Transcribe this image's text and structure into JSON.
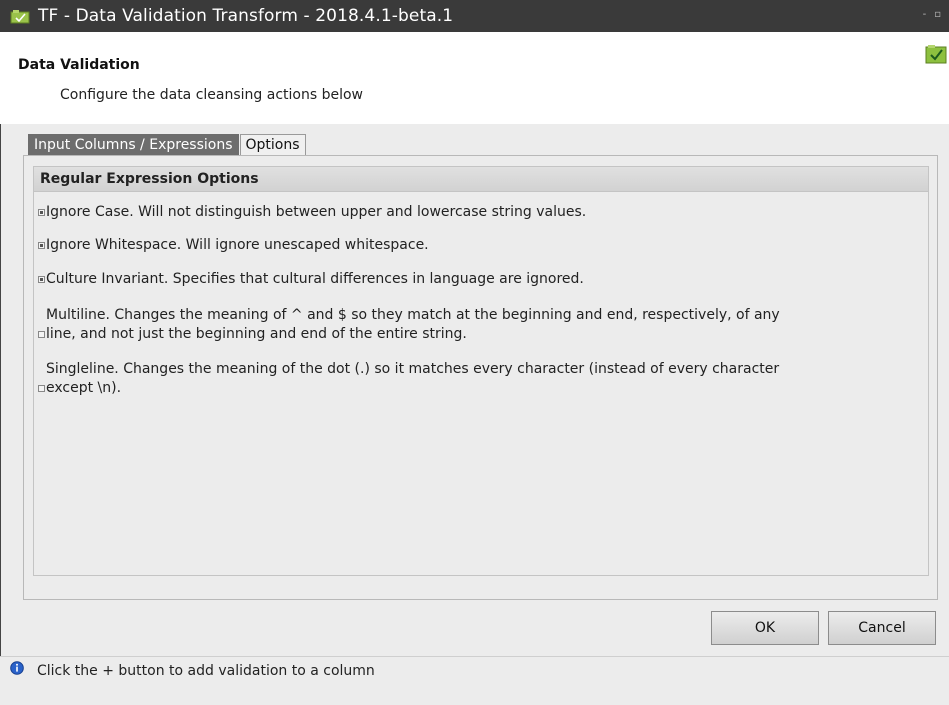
{
  "window": {
    "title": "TF - Data Validation Transform - 2018.4.1-beta.1",
    "controls": [
      "-",
      "▫"
    ]
  },
  "header": {
    "title": "Data Validation",
    "subtitle": "Configure the data cleansing actions below"
  },
  "tabs": [
    {
      "label": "Input Columns / Expressions",
      "active": false
    },
    {
      "label": "Options",
      "active": true
    }
  ],
  "options_group": {
    "title": "Regular Expression Options",
    "items": [
      {
        "label": "Ignore Case. Will not distinguish between upper and lowercase string values.",
        "checked": true
      },
      {
        "label": "Ignore Whitespace. Will ignore unescaped whitespace.",
        "checked": true
      },
      {
        "label": "Culture Invariant. Specifies that cultural differences in language are ignored.",
        "checked": true
      },
      {
        "label": "Multiline. Changes the meaning of ^ and $ so they match at the beginning and end, respectively, of any line, and not just the beginning and end of the entire string.",
        "checked": false
      },
      {
        "label": "Singleline. Changes the meaning of the dot (.) so it matches every character (instead of every character except \\n).",
        "checked": false
      }
    ]
  },
  "buttons": {
    "ok": "OK",
    "cancel": "Cancel"
  },
  "status": {
    "text": "Click the + button to add validation to a column",
    "icon": "info-icon"
  },
  "colors": {
    "titlebar": "#3a3a3a",
    "inactive_tab": "#6d6d6d",
    "accent_green": "#7fb93a",
    "info_blue": "#2a62c9"
  }
}
